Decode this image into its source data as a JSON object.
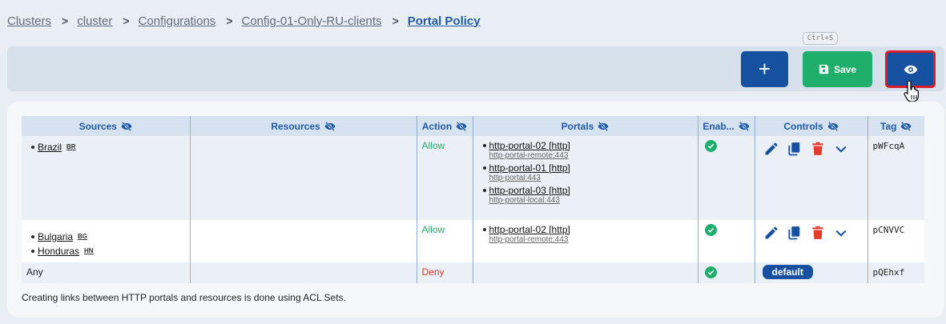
{
  "breadcrumb": {
    "items": [
      "Clusters",
      "cluster",
      "Configurations",
      "Config-01-Only-RU-clients"
    ],
    "separator": ">",
    "current": "Portal Policy"
  },
  "toolbar": {
    "shortcut": "Ctrl+S",
    "add_label": "+",
    "save_label": "Save"
  },
  "table": {
    "headers": {
      "sources": "Sources",
      "resources": "Resources",
      "action": "Action",
      "portals": "Portals",
      "enabled": "Enab...",
      "controls": "Controls",
      "tag": "Tag"
    },
    "rows": [
      {
        "sources": [
          {
            "name": "Brazil",
            "code": "BR"
          }
        ],
        "action": "Allow",
        "portals": [
          {
            "name": "http-portal-02 [http]",
            "address": "http-portal-remote:443"
          },
          {
            "name": "http-portal-01 [http]",
            "address": "http-portal:443"
          },
          {
            "name": "http-portal-03 [http]",
            "address": "http-portal-local:443"
          }
        ],
        "tag": "pWFcqA"
      },
      {
        "sources": [
          {
            "name": "Bulgaria",
            "code": "BG"
          },
          {
            "name": "Honduras",
            "code": "HN"
          }
        ],
        "action": "Allow",
        "portals": [
          {
            "name": "http-portal-02 [http]",
            "address": "http-portal-remote:443"
          }
        ],
        "tag": "pCNVVC"
      },
      {
        "sources_text": "Any",
        "action": "Deny",
        "default_label": "default",
        "tag": "pQEhxf"
      }
    ]
  },
  "footnote": "Creating links between HTTP portals and resources is done using ACL Sets.",
  "colors": {
    "primary": "#1650a0",
    "success": "#1fae6b",
    "danger": "#d83a2a",
    "highlight_border": "#d81e2a"
  },
  "icons": {
    "header": "eye-slash-icon",
    "save": "floppy-disk-icon",
    "view": "eye-icon",
    "enabled": "check-circle-icon",
    "edit": "pencil-icon",
    "copy": "copy-icon",
    "delete": "trash-icon",
    "expand": "chevron-down-icon"
  }
}
